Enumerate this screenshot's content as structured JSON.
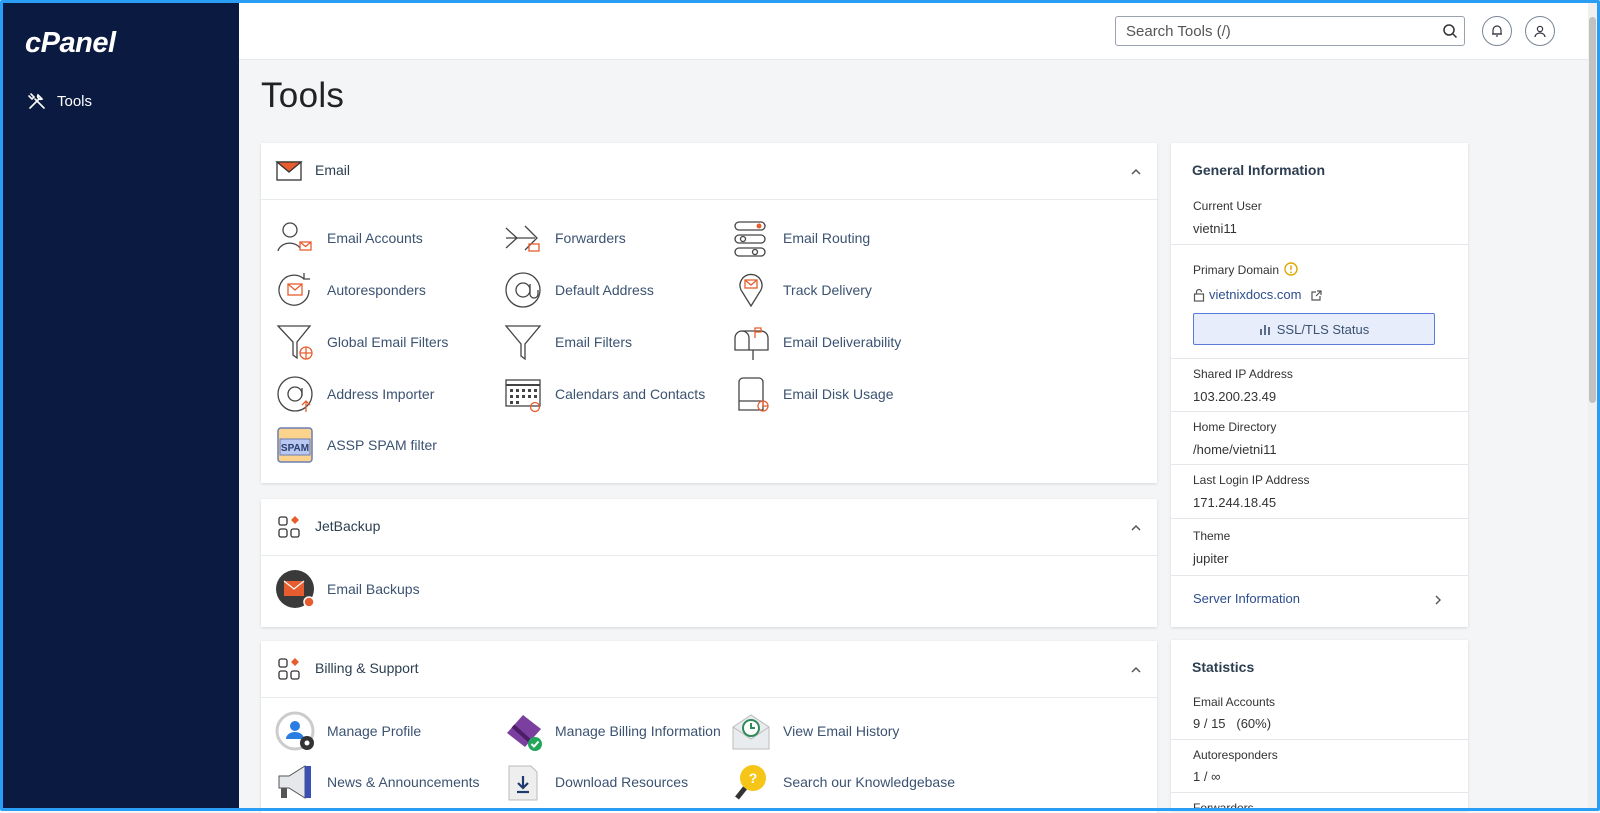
{
  "sidebar": {
    "logo": "cPanel",
    "nav": [
      {
        "label": "Tools",
        "icon": "tools-icon"
      }
    ]
  },
  "header": {
    "search_placeholder": "Search Tools (/)"
  },
  "page_title": "Tools",
  "sections": [
    {
      "title": "Email",
      "tools": [
        {
          "label": "Email Accounts",
          "icon": "email-accounts-icon"
        },
        {
          "label": "Forwarders",
          "icon": "forwarders-icon"
        },
        {
          "label": "Email Routing",
          "icon": "email-routing-icon"
        },
        {
          "label": "Autoresponders",
          "icon": "autoresponders-icon"
        },
        {
          "label": "Default Address",
          "icon": "default-address-icon"
        },
        {
          "label": "Track Delivery",
          "icon": "track-delivery-icon"
        },
        {
          "label": "Global Email Filters",
          "icon": "global-filter-icon"
        },
        {
          "label": "Email Filters",
          "icon": "filter-icon"
        },
        {
          "label": "Email Deliverability",
          "icon": "mailbox-icon"
        },
        {
          "label": "Address Importer",
          "icon": "address-importer-icon"
        },
        {
          "label": "Calendars and Contacts",
          "icon": "calendar-icon"
        },
        {
          "label": "Email Disk Usage",
          "icon": "disk-usage-icon"
        },
        {
          "label": "ASSP SPAM filter",
          "icon": "spam-icon",
          "icon_text": "SPAM"
        }
      ]
    },
    {
      "title": "JetBackup",
      "tools": [
        {
          "label": "Email Backups",
          "icon": "email-backups-icon"
        }
      ]
    },
    {
      "title": "Billing & Support",
      "tools": [
        {
          "label": "Manage Profile",
          "icon": "profile-icon"
        },
        {
          "label": "Manage Billing Information",
          "icon": "credit-card-icon"
        },
        {
          "label": "View Email History",
          "icon": "email-history-icon"
        },
        {
          "label": "News & Announcements",
          "icon": "megaphone-icon"
        },
        {
          "label": "Download Resources",
          "icon": "download-icon"
        },
        {
          "label": "Search our Knowledgebase",
          "icon": "knowledgebase-icon"
        }
      ]
    }
  ],
  "general_info": {
    "title": "General Information",
    "current_user_label": "Current User",
    "current_user": "vietni11",
    "primary_domain_label": "Primary Domain",
    "primary_domain": "vietnixdocs.com",
    "ssl_button": "SSL/TLS Status",
    "shared_ip_label": "Shared IP Address",
    "shared_ip": "103.200.23.49",
    "home_dir_label": "Home Directory",
    "home_dir": "/home/vietni11",
    "last_login_label": "Last Login IP Address",
    "last_login": "171.244.18.45",
    "theme_label": "Theme",
    "theme": "jupiter",
    "server_info": "Server Information"
  },
  "statistics": {
    "title": "Statistics",
    "email_accounts_label": "Email Accounts",
    "email_accounts": "9 / 15   (60%)",
    "autoresponders_label": "Autoresponders",
    "autoresponders": "1 / ∞",
    "forwarders_label": "Forwarders"
  },
  "colors": {
    "sidebar": "#0b1a40",
    "accent": "#e85d2f",
    "link": "#3b5271"
  }
}
